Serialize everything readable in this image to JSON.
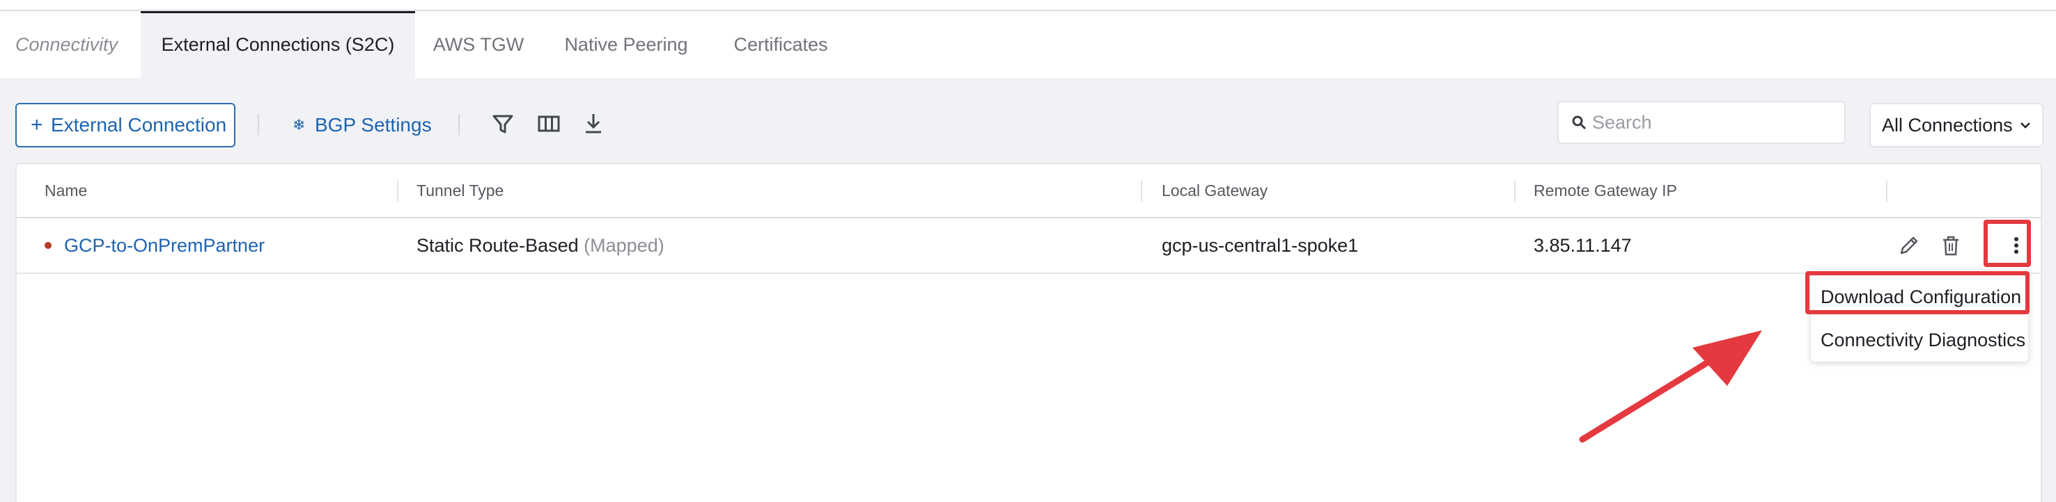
{
  "tabs": {
    "crumb": "Connectivity",
    "items": [
      {
        "label": "External Connections (S2C)",
        "active": true
      },
      {
        "label": "AWS TGW",
        "active": false
      },
      {
        "label": "Native Peering",
        "active": false
      },
      {
        "label": "Certificates",
        "active": false
      }
    ]
  },
  "toolbar": {
    "add_icon": "+",
    "add_label": "External Connection",
    "bgp_icon": "gear-icon",
    "bgp_label": "BGP Settings",
    "tools": [
      "filter-icon",
      "columns-icon",
      "download-icon"
    ]
  },
  "search": {
    "placeholder": "Search",
    "value": ""
  },
  "filter_select": {
    "value": "All Connections"
  },
  "table": {
    "columns": [
      "Name",
      "Tunnel Type",
      "Local Gateway",
      "Remote Gateway IP"
    ],
    "rows": [
      {
        "name": "GCP-to-OnPremPartner",
        "status_color": "#b33a2d",
        "tunnel_type": "Static Route-Based",
        "tunnel_note": "(Mapped)",
        "local_gateway": "gcp-us-central1-spoke1",
        "remote_gateway_ip": "3.85.11.147",
        "actions": [
          "edit-icon",
          "trash-icon",
          "more-vertical-icon"
        ]
      }
    ]
  },
  "context_menu": {
    "items": [
      "Download Configuration",
      "Connectivity Diagnostics"
    ],
    "highlighted": "Download Configuration"
  },
  "colors": {
    "accent": "#1e63b0",
    "annotation": "#e3393f",
    "status_down": "#b33a2d"
  }
}
